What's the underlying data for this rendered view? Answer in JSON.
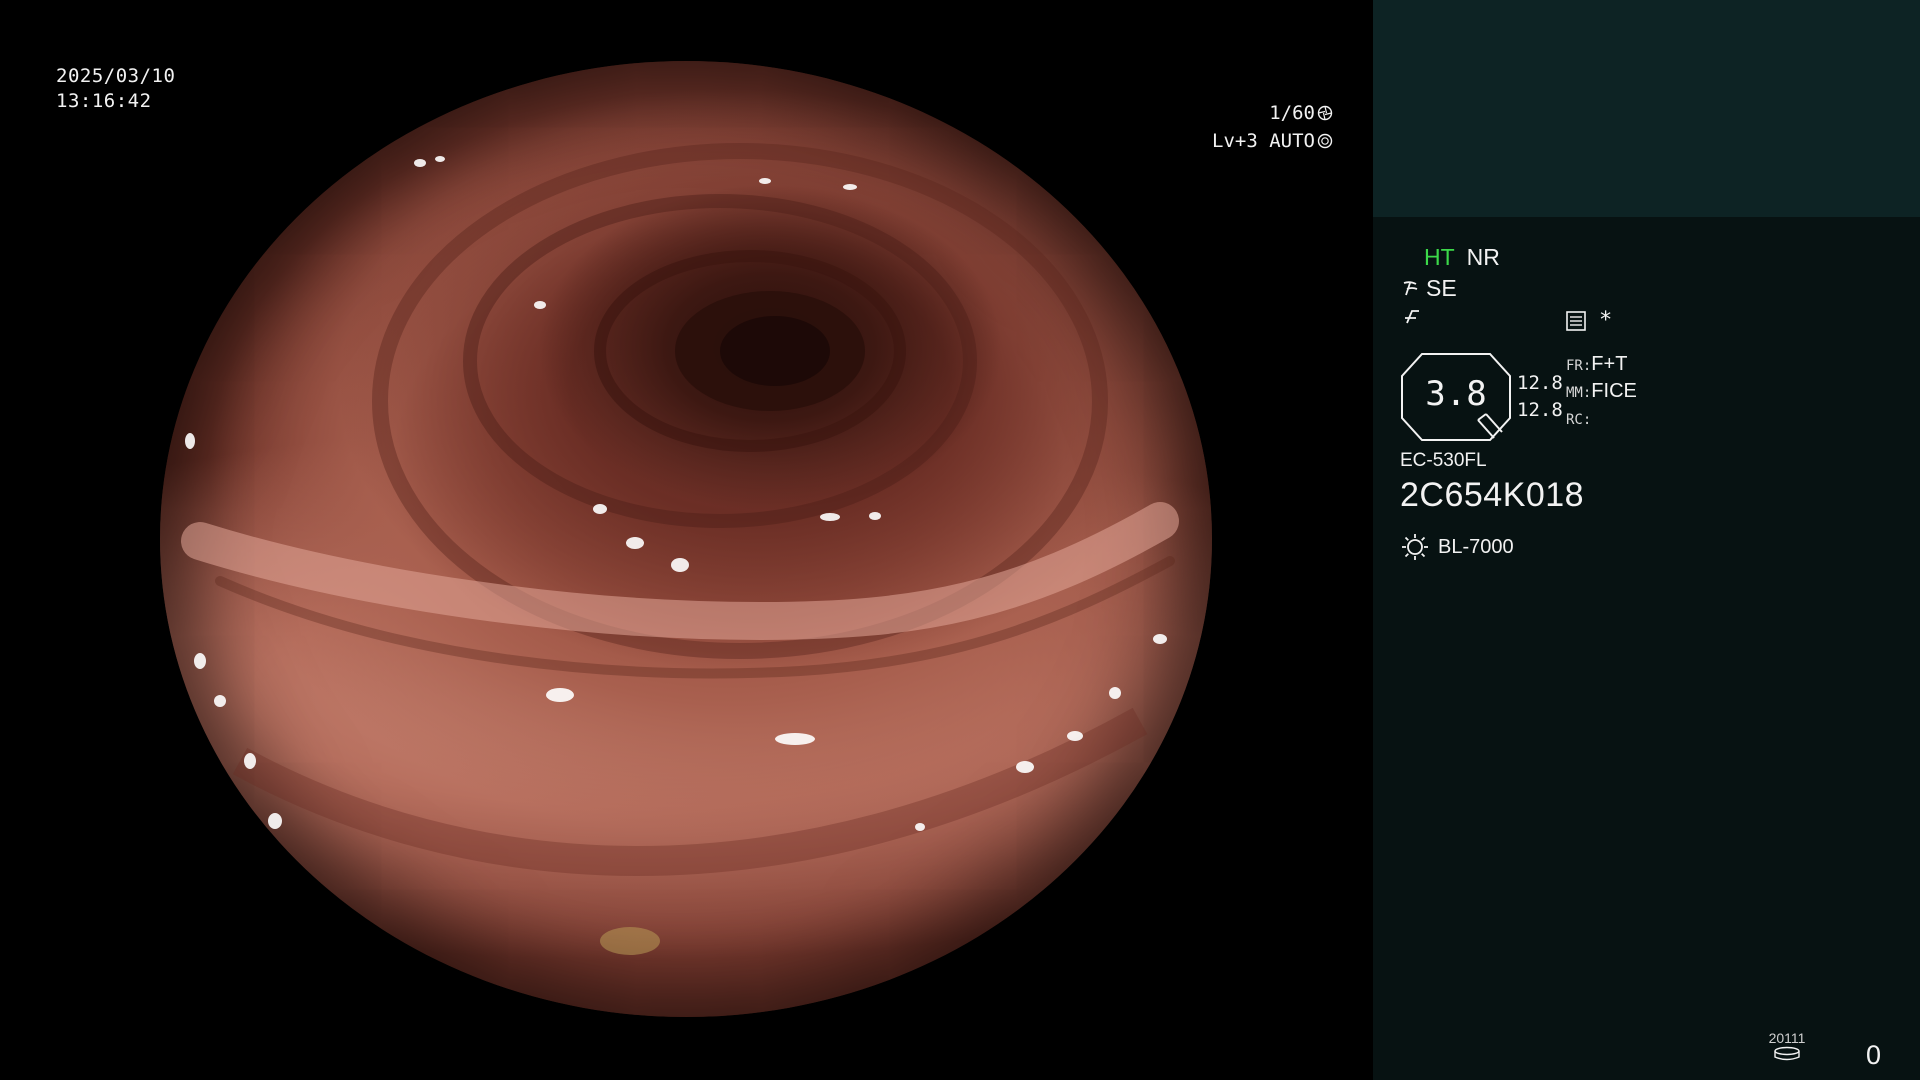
{
  "video": {
    "date": "2025/03/10",
    "time": "13:16:42",
    "shutter": "1/60",
    "exposure": "Lv+3 AUTO"
  },
  "info": {
    "mode_ht": "HT",
    "mode_nr": "NR",
    "se_label": "SE",
    "star": "*",
    "zoom_value": "3.8",
    "zoom_lines": [
      "12.8",
      "12.8"
    ],
    "params": [
      {
        "label": "FR:",
        "value": "F+T"
      },
      {
        "label": "MM:",
        "value": "FICE"
      },
      {
        "label": "RC:",
        "value": ""
      }
    ],
    "scope_model": "EC-530FL",
    "scope_serial": "2C654K018",
    "light_source": "BL-7000",
    "record_number": "20111",
    "counter": "0"
  },
  "colors": {
    "ht_green": "#3cd94a",
    "panel_bg": "#071212",
    "thumb_bg": "#0d2324"
  },
  "icons": [
    "aperture-icon",
    "auto-iris-icon",
    "structure-enhance-icon",
    "freeze-icon",
    "settings-list-icon",
    "light-source-icon",
    "recorder-icon"
  ]
}
